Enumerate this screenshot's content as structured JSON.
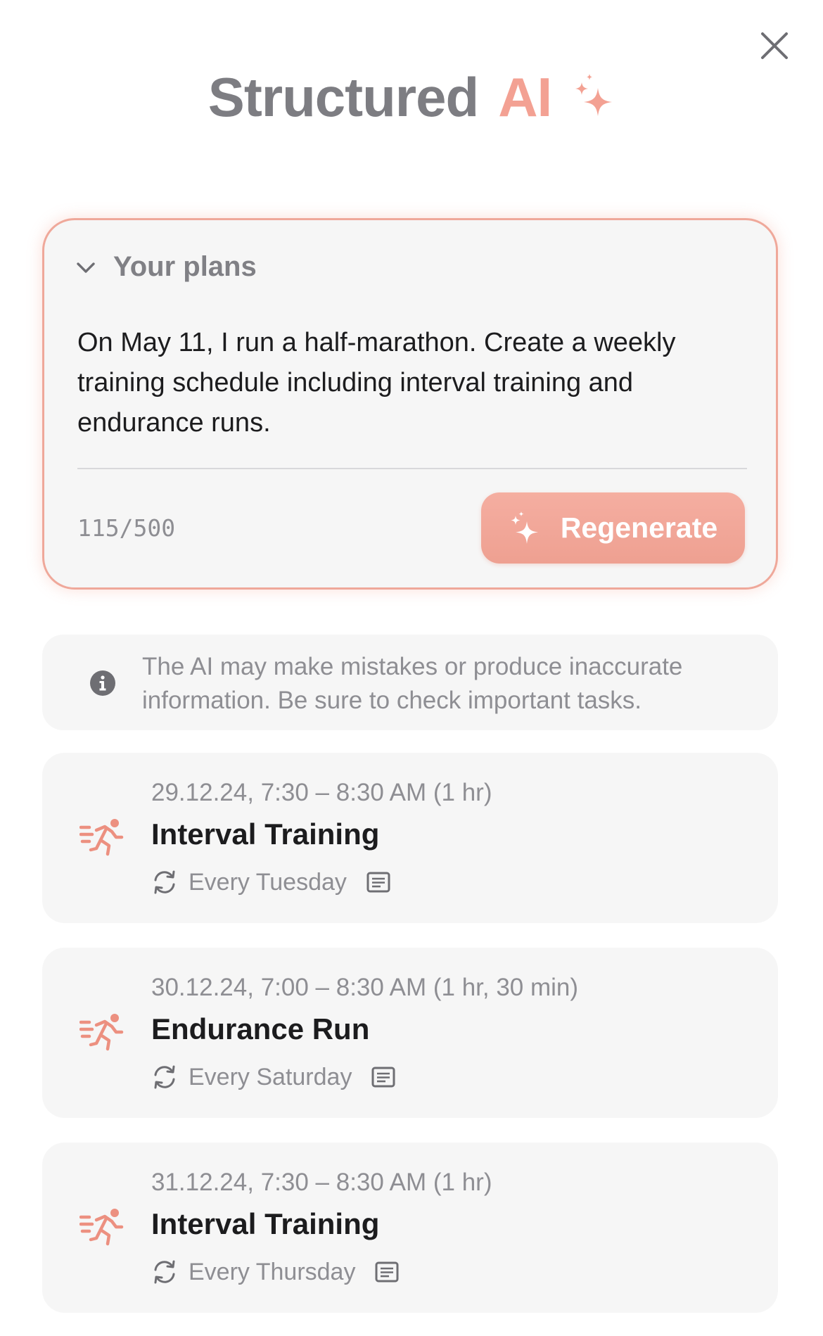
{
  "header": {
    "title": "Structured",
    "title_accent": "AI",
    "sparkle_icon": "sparkles-icon",
    "close_icon": "close-icon"
  },
  "plans": {
    "title": "Your plans",
    "text": "On May 11, I run a half-marathon. Create a weekly training schedule including interval training and endurance runs.",
    "char_count": "115/500",
    "button_label": "Regenerate"
  },
  "disclaimer": {
    "text": "The AI may make mistakes or produce inaccurate information. Be sure to check important tasks."
  },
  "tasks": [
    {
      "time": "29.12.24, 7:30 – 8:30 AM (1 hr)",
      "title": "Interval Training",
      "repeat": "Every Tuesday",
      "icon": "running-person-icon"
    },
    {
      "time": "30.12.24, 7:00 – 8:30 AM (1 hr, 30 min)",
      "title": "Endurance Run",
      "repeat": "Every Saturday",
      "icon": "running-person-icon"
    },
    {
      "time": "31.12.24, 7:30 – 8:30 AM (1 hr)",
      "title": "Interval Training",
      "repeat": "Every Thursday",
      "icon": "running-person-icon"
    }
  ],
  "colors": {
    "accent": "#f3a193",
    "title_gray": "#7d7d82",
    "card_bg": "#f6f6f6",
    "secondary_text": "#8e8e93"
  }
}
